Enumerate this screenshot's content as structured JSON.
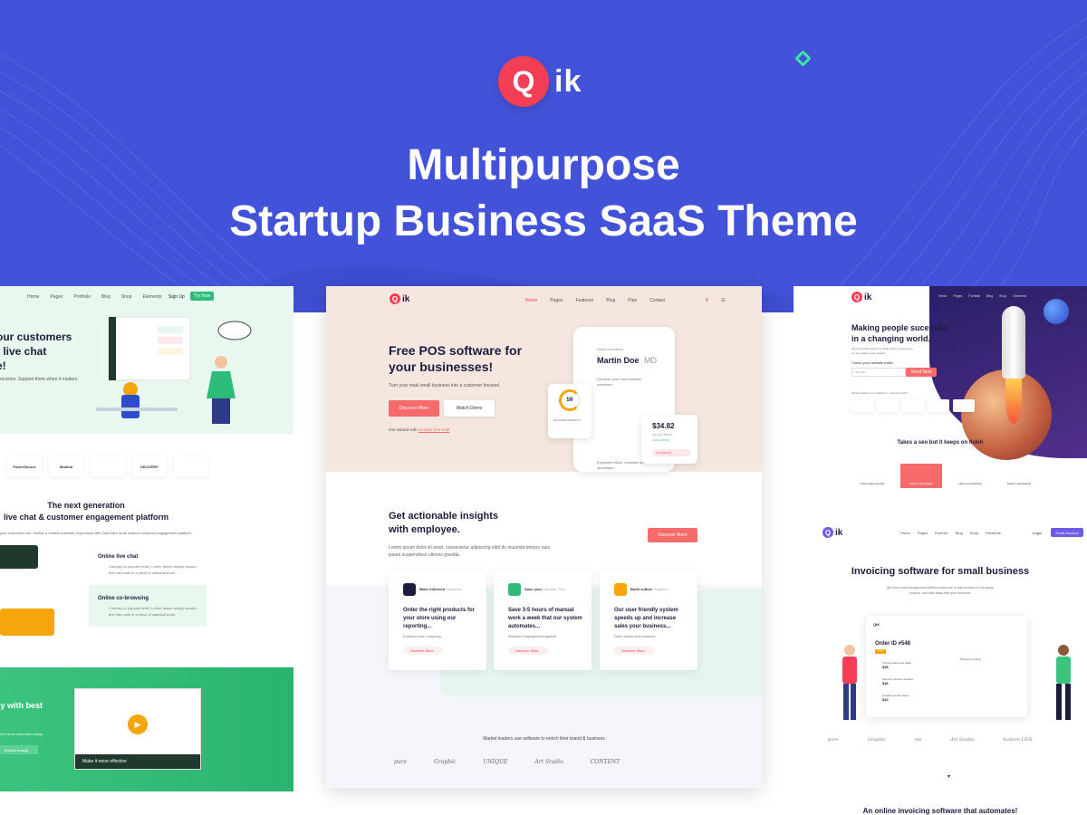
{
  "banner": {
    "logo_mark": "Q",
    "logo_word": "ik",
    "headline_line1": "Multipurpose",
    "headline_line2": "Startup Business SaaS Theme",
    "bg_color": "#4353d9",
    "accent_color": "#f43e55"
  },
  "left_panel": {
    "nav": [
      "Home",
      "Pages",
      "Portfolio",
      "Blog",
      "Shop",
      "Elements"
    ],
    "signup": "Sign Up",
    "try_now": "Try Now",
    "hero_title_1": "our customers",
    "hero_title_2": "t live chat",
    "hero_title_3": "e!",
    "hero_sub": "recision. Support them when it matters.",
    "brands": [
      "PowerSource",
      "Modina",
      "",
      "DELIVERY",
      ""
    ],
    "section_title_1": "The next generation",
    "section_title_2": "live chat & customer engagement platform",
    "section_sub": "your customers are. Deliver a unified customer experience with QikChat's multi channel customer engagement platform",
    "feature1_title": "Online live chat",
    "feature1_desc": "Contrary to popular belief, Lorem Ipsum simply random text has roots in a piece of classical book.",
    "feature2_title": "Online co-browsing",
    "feature2_desc": "Contrary to popular belief, Lorem Ipsum simply random text has roots in a piece of classical book.",
    "green_title": "ly with best",
    "green_sub": "lore more customers today",
    "green_btn": "Venture trading",
    "video_caption": "Make it more effective"
  },
  "center_panel": {
    "logo_mark": "Q",
    "logo_word": "ik",
    "nav": [
      "Home",
      "Pages",
      "Features",
      "Blog",
      "Plan",
      "Contact"
    ],
    "hero_title_1": "Free POS software for",
    "hero_title_2": "your businesses!",
    "hero_sub": "Turn your retail small business into a customer focused.",
    "discover_btn": "Discover More",
    "watch_btn": "Watch Demo",
    "get_started": "Get started with",
    "free_trial": "14 days free trial!",
    "phone_select": "Select members",
    "phone_name": "Martin Doe",
    "phone_md": "MD",
    "phone_discover": "Discover your more session members",
    "phone_emp": "Employee hikes, increase and appraisals.",
    "donut_value": "59",
    "donut_label": "MULTIORA PAGES TL",
    "price_value": "$34.82",
    "price_sub": "Payment 100.00",
    "price_pct": "+8.4% [54.64]",
    "price_btn": "Join Member",
    "s2_title_1": "Get actionable insights",
    "s2_title_2": "with employee.",
    "s2_sub": "Lorem ipsum dolor sit amet, consectetur adipiscing elitd do eiusmod tempor ouis ipsum suspendisse ultrices gravida.",
    "s2_btn": "Discover More",
    "cards": [
      {
        "label": "Make informed",
        "label_muted": "Decisions",
        "title": "Order the right products for your store using our reporting...",
        "desc": "Examine your company.",
        "more": "Discover More",
        "color": "#1c1d3e"
      },
      {
        "label": "Save your",
        "label_muted": "valuable Time",
        "title": "Save 3-5 hours of manual work a week that our system automates...",
        "desc": "Measure engagement against.",
        "more": "Discover More",
        "color": "#2cbb79"
      },
      {
        "label": "Build culture",
        "label_muted": "Together",
        "title": "Our user friendly system speeds up and increase sales your business...",
        "desc": "Drive action and measure.",
        "more": "Discover More",
        "color": "#f6a50b"
      }
    ],
    "market_text": "Market leaders use software to enrich their brand & business",
    "logos": [
      "pure",
      "Graphic",
      "UNIQUE",
      "Art Studio",
      "CONTENT"
    ]
  },
  "right_top_panel": {
    "logo_mark": "Q",
    "logo_word": "ik",
    "nav": [
      "Home",
      "Pages",
      "Portfolio",
      "Blog",
      "Shop",
      "Elements"
    ],
    "title_1": "Making people sucessful",
    "title_2": "in a changing world.",
    "sub": "Qik the small business in whats factor convenience, we are explore new markets.",
    "check": "Check your website traffic",
    "field_placeholder": "Site URL",
    "send_btn": "Send Now",
    "trusted": "Market leaders use software to rich their brand",
    "takes": "Takes a seo but it keeps on tickin",
    "services": [
      "Cloud sales security",
      "Search optimization",
      "High end analyzing",
      "Search optimization"
    ]
  },
  "right_bottom_panel": {
    "logo_mark": "Q",
    "logo_word": "ik",
    "nav": [
      "Home",
      "Pages",
      "Portfolio",
      "Blog",
      "Shop",
      "Elements"
    ],
    "login": "Login",
    "get_account": "Great Account",
    "title": "Invoicing software for small business",
    "sub": "Qik is the work management platform team use to stay focused on the goals, projects, and daily tasks that grow business.",
    "app_title": "QIK",
    "order_label": "Order ID #548",
    "paid": "Paid",
    "items": [
      {
        "name": "Trendy brand new video",
        "price": "$36"
      },
      {
        "name": "Woman's woolen sweater",
        "price": "$36"
      },
      {
        "name": "Creative woolen dress",
        "price": "$42"
      }
    ],
    "payment_method": "Payment method",
    "logos": [
      "pure",
      "Graphic",
      "ms",
      "Art Studio",
      "fashion LIVE"
    ],
    "bottom_title": "An online invoicing software that automates!"
  }
}
